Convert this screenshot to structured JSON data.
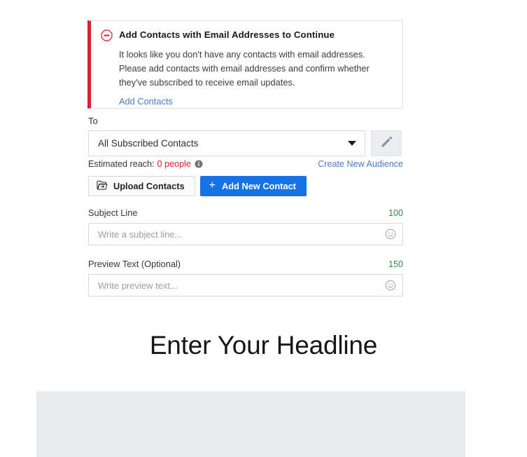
{
  "alert": {
    "icon": "stop-minus-icon",
    "title": "Add Contacts with Email Addresses to Continue",
    "body": "It looks like you don't have any contacts with email addresses. Please add contacts with email addresses and confirm whether they've subscribed to receive email updates.",
    "link_label": "Add Contacts",
    "accent_color": "#d8232a",
    "link_color": "#4a7cbf"
  },
  "recipients": {
    "label": "To",
    "selected_audience": "All Subscribed Contacts",
    "caret_icon": "chevron-down-icon",
    "edit_icon": "pencil-icon",
    "reach_label": "Estimated reach:",
    "reach_value": "0 people",
    "reach_color": "#d8232a",
    "info_icon": "info-icon",
    "create_audience_label": "Create New Audience"
  },
  "actions": {
    "upload_icon": "folder-open-icon",
    "upload_label": "Upload Contacts",
    "add_icon": "plus-icon",
    "add_label": "Add New Contact",
    "add_button_color": "#1673e6"
  },
  "subject": {
    "label": "Subject Line",
    "counter": "100",
    "counter_color": "#2f8b46",
    "value": "",
    "placeholder": "Write a subject line...",
    "emoji_icon": "smiley-face-icon"
  },
  "preview": {
    "label": "Preview Text (Optional)",
    "counter": "150",
    "counter_color": "#2f8b46",
    "value": "",
    "placeholder": "Write preview text...",
    "emoji_icon": "smiley-face-icon"
  },
  "canvas": {
    "headline": "Enter Your Headline",
    "image_block_color": "#e9eaee"
  }
}
